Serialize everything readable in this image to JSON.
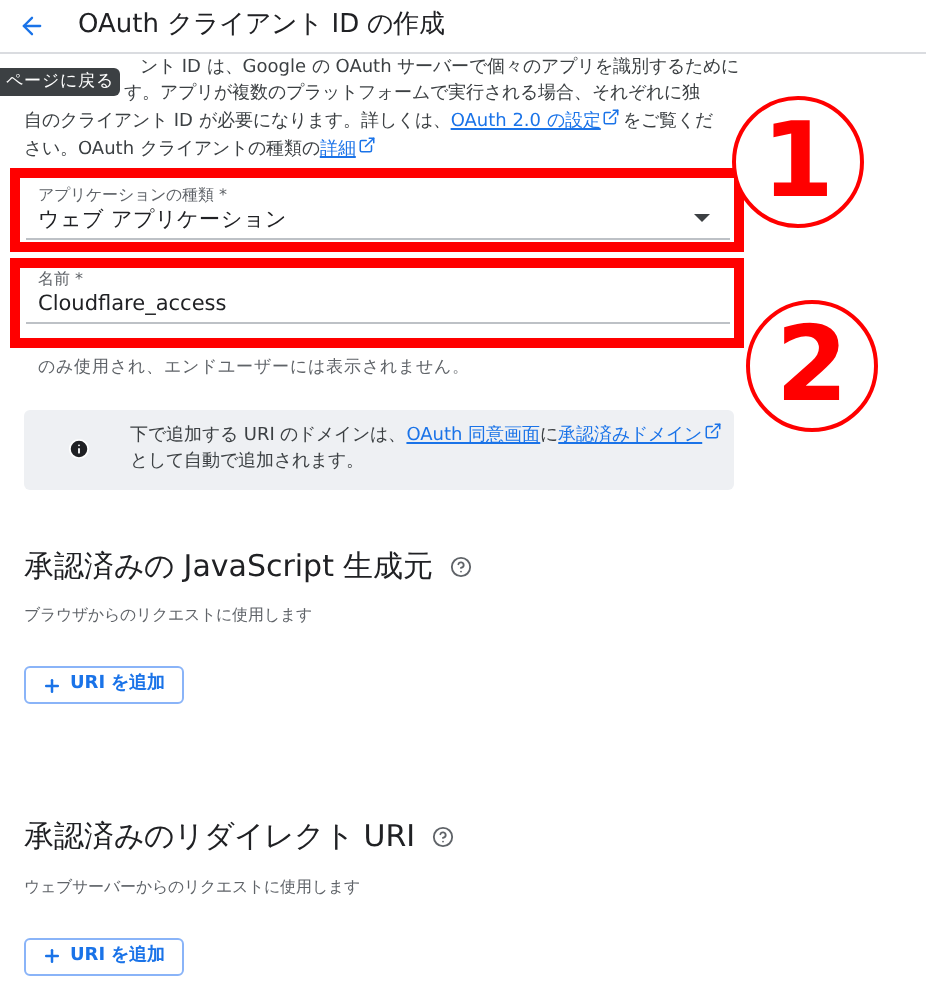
{
  "header": {
    "title": "OAuth クライアント ID の作成"
  },
  "tooltip": "ページに戻る",
  "intro": {
    "lines": [
      "ント ID は、Google の OAuth サーバーで個々のアプリを識別するために",
      "す。アプリが複数のプラットフォームで実行される場合、それぞれに独"
    ],
    "before_link": "自のクライアント ID が必要になります。詳しくは、",
    "link": "OAuth 2.0 の設定",
    "middle": "をご覧ください。OAuth クライアントの種類の",
    "link2": "詳細"
  },
  "app_type": {
    "label": "アプリケーションの種類 *",
    "value": "ウェブ アプリケーション"
  },
  "name": {
    "label": "名前 *",
    "value": "Cloudflare_access",
    "helper": "のみ使用され、エンドユーザーには表示されません。"
  },
  "info": {
    "text_before": "下で追加する URI のドメインは、",
    "link": "OAuth 同意画面",
    "text_middle": "に",
    "link2": "承認済みドメイン",
    "text_after": "として自動で追加されます。"
  },
  "sections": [
    {
      "title": "承認済みの JavaScript 生成元",
      "subtitle": "ブラウザからのリクエストに使用します",
      "button": "URI を追加"
    },
    {
      "title": "承認済みのリダイレクト URI",
      "subtitle": "ウェブサーバーからのリクエストに使用します",
      "button": "URI を追加"
    }
  ],
  "annotations": [
    {
      "number": "1"
    },
    {
      "number": "2"
    }
  ]
}
